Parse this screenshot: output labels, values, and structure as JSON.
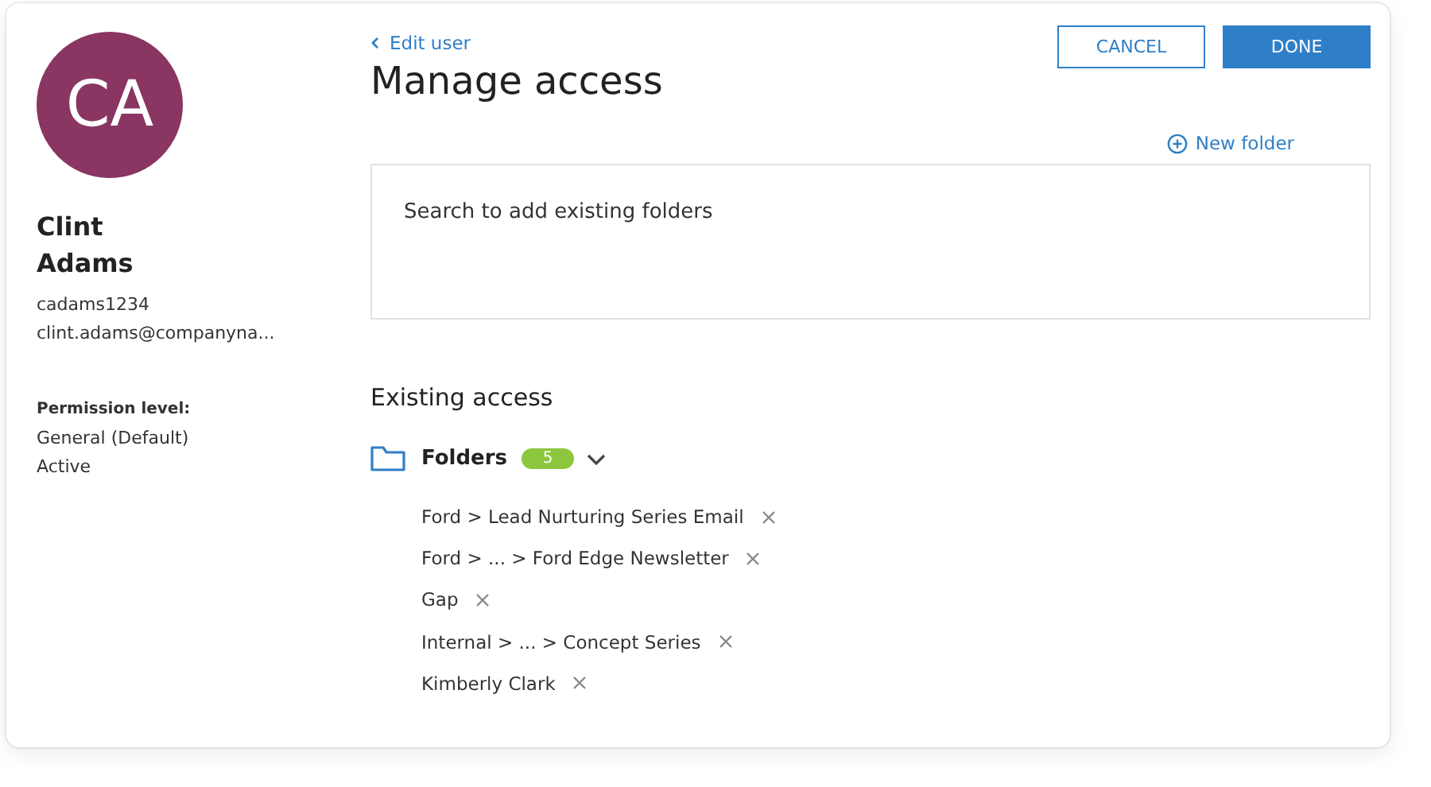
{
  "user": {
    "initials": "CA",
    "first_name": "Clint",
    "last_name": "Adams",
    "username": "cadams1234",
    "email": "clint.adams@companyna...",
    "permission_label": "Permission level:",
    "permission": "General (Default)",
    "status": "Active"
  },
  "back_link": "Edit user",
  "title": "Manage access",
  "buttons": [
    {
      "label": "CANCEL",
      "kind": "secondary"
    },
    {
      "label": "DONE",
      "kind": "primary"
    }
  ],
  "new_folder": "New folder",
  "search": {
    "placeholder": "Search to add existing folders"
  },
  "existing_title": "Existing access",
  "folders": {
    "label": "Folders",
    "count": "5",
    "expanded": true,
    "items": [
      "Ford > Lead Nurturing Series Email",
      "Ford > ... > Ford Edge Newsletter",
      "Gap",
      "Internal > ... > Concept Series",
      "Kimberly Clark"
    ]
  }
}
